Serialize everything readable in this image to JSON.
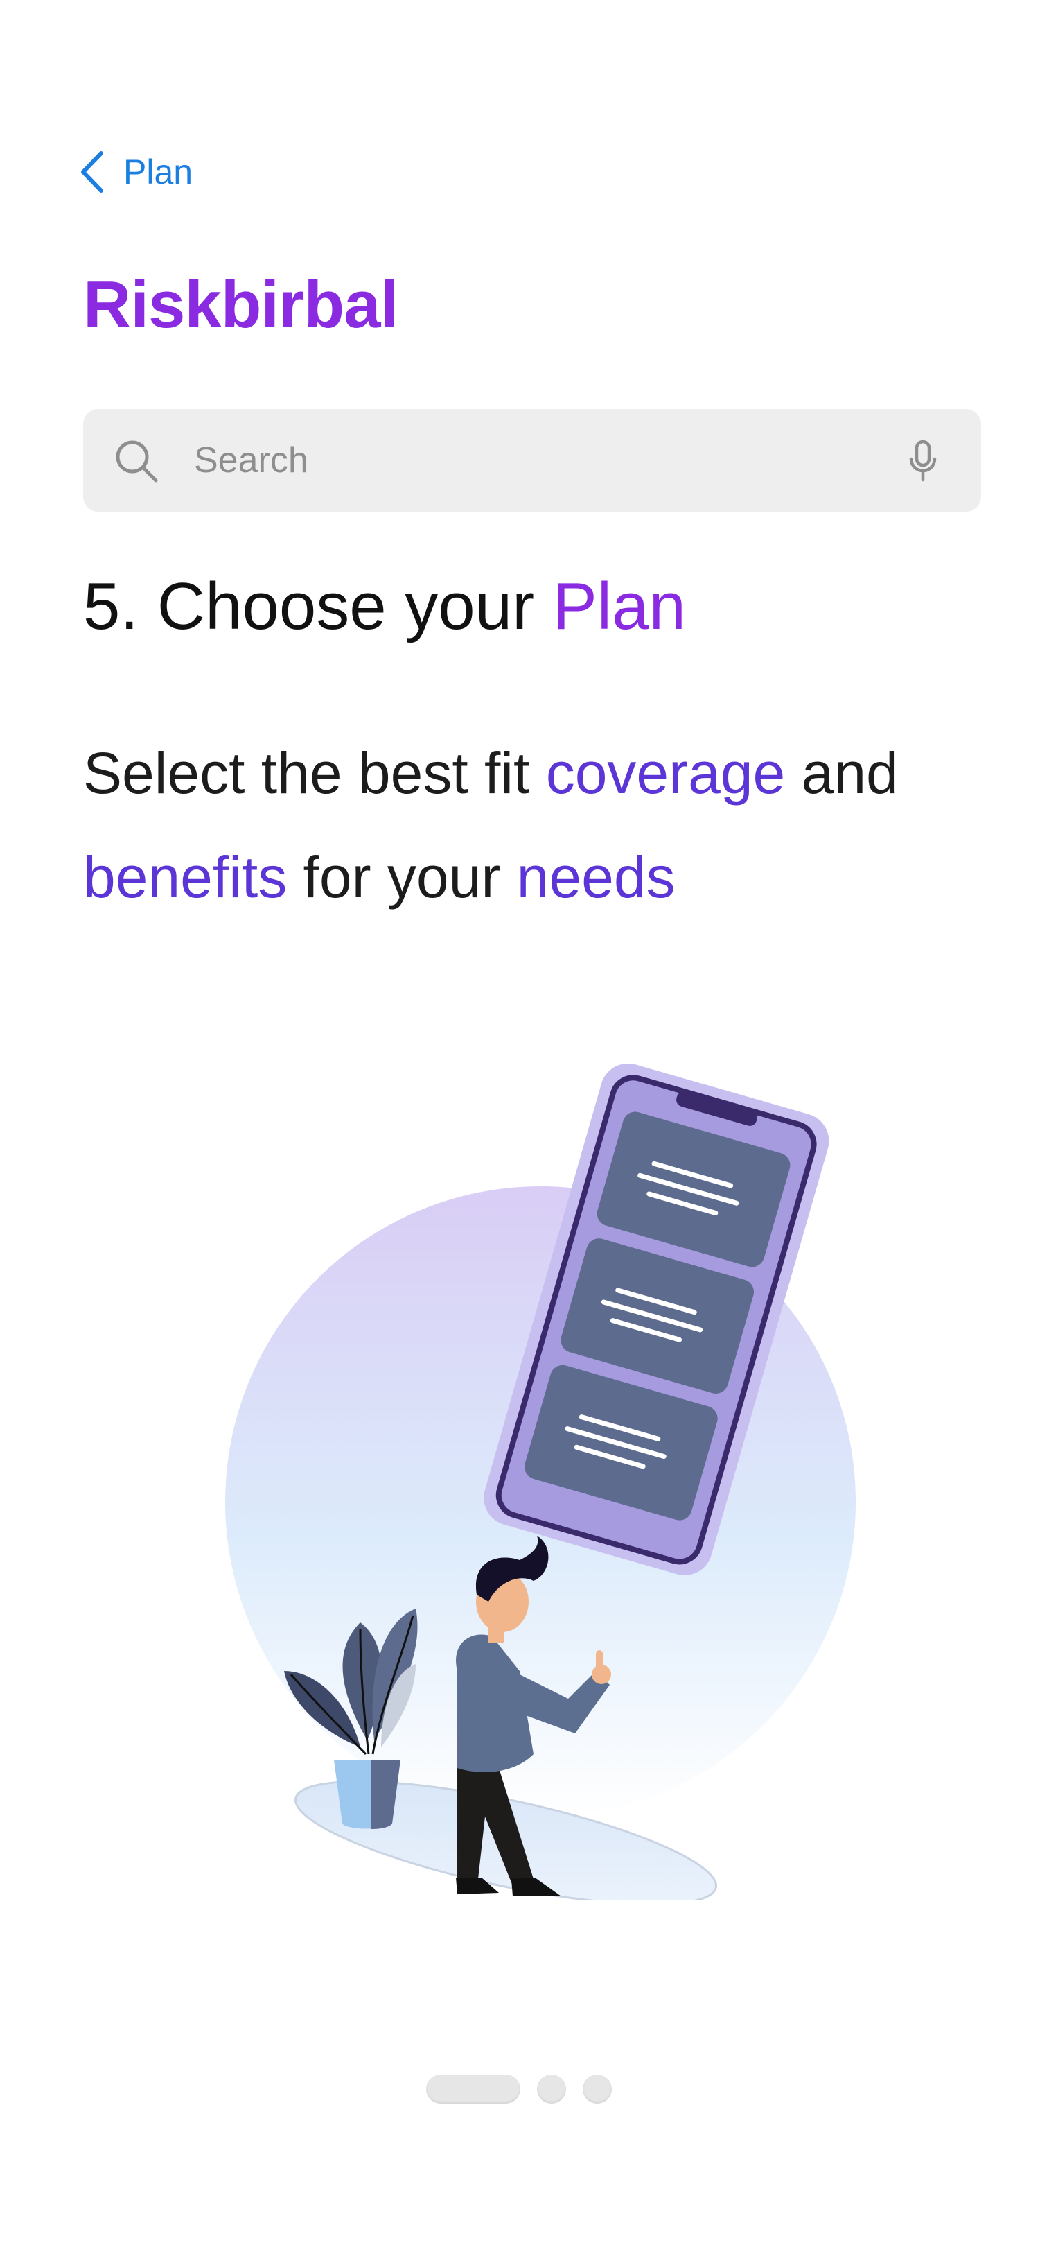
{
  "nav": {
    "back_label": "Plan",
    "back_icon": "chevron-left-icon"
  },
  "app": {
    "title": "Riskbirbal"
  },
  "search": {
    "placeholder": "Search",
    "search_icon": "search-icon",
    "mic_icon": "microphone-icon"
  },
  "step": {
    "heading_prefix": "5. Choose your ",
    "heading_accent": "Plan",
    "desc_part1": "Select the best fit ",
    "desc_accent1": "coverage",
    "desc_part2": " and ",
    "desc_accent2": "benefits",
    "desc_part3": " for your ",
    "desc_accent3": "needs"
  },
  "pager": {
    "total_pages": 3,
    "active_index": 0
  },
  "colors": {
    "brand_purple": "#8a2be2",
    "accent_indigo": "#5b35d6",
    "link_blue": "#1a7fe0",
    "search_bg": "#eeeeee"
  }
}
